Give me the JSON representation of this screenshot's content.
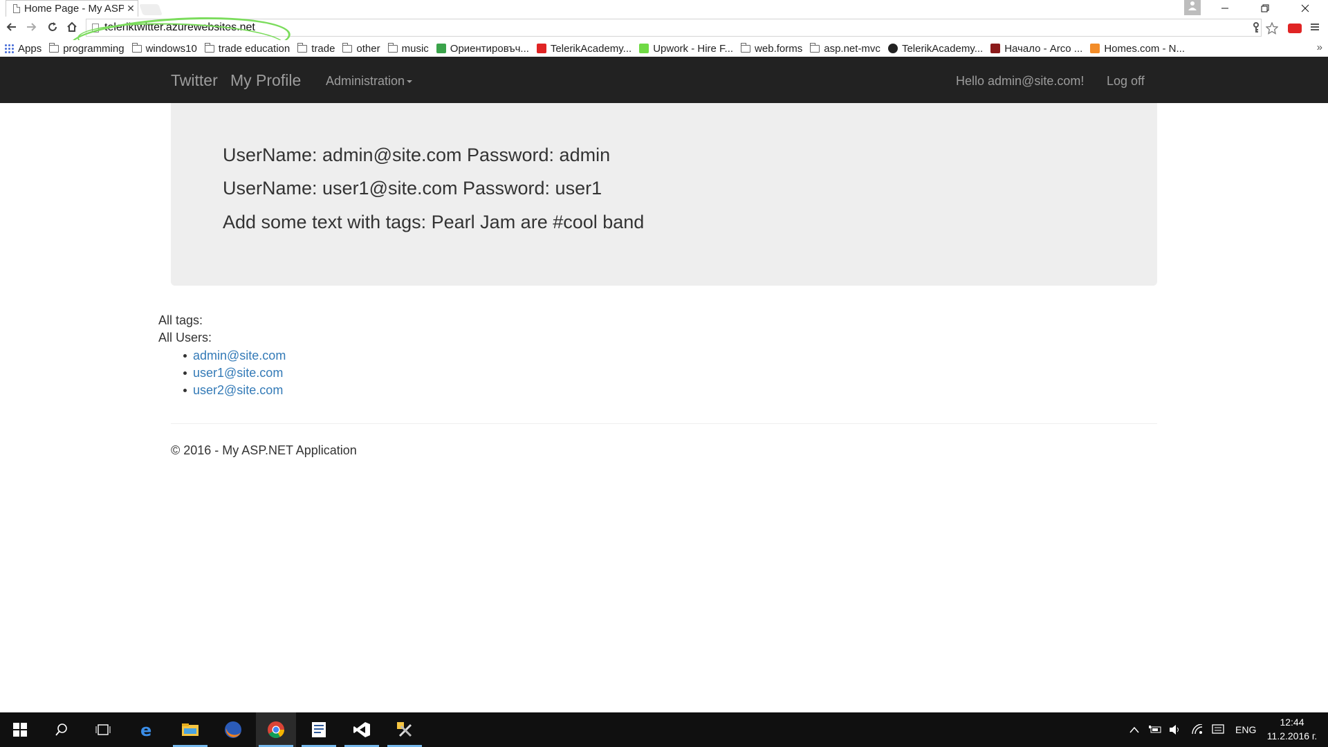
{
  "browser": {
    "tab_title": "Home Page - My ASP",
    "tab_close": "✕",
    "url": "teleriktwitter.azurewebsites.net",
    "bookmarks": [
      {
        "label": "Apps",
        "icon": "apps-grid-icon"
      },
      {
        "label": "programming",
        "icon": "folder-icon"
      },
      {
        "label": "windows10",
        "icon": "folder-icon"
      },
      {
        "label": "trade education",
        "icon": "folder-icon"
      },
      {
        "label": "trade",
        "icon": "folder-icon"
      },
      {
        "label": "other",
        "icon": "folder-icon"
      },
      {
        "label": "music",
        "icon": "folder-icon"
      },
      {
        "label": "Ориентировъч...",
        "icon": "green-star-icon"
      },
      {
        "label": "TelerikAcademy...",
        "icon": "youtube-icon"
      },
      {
        "label": "Upwork - Hire F...",
        "icon": "upwork-icon"
      },
      {
        "label": "web.forms",
        "icon": "folder-icon"
      },
      {
        "label": "asp.net-mvc",
        "icon": "folder-icon"
      },
      {
        "label": "TelerikAcademy...",
        "icon": "github-icon"
      },
      {
        "label": "Начало - Arco ...",
        "icon": "arco-icon"
      },
      {
        "label": "Homes.com - N...",
        "icon": "homes-icon"
      }
    ],
    "bookmarks_more": "»"
  },
  "navbar": {
    "brand": "Twitter",
    "my_profile": "My Profile",
    "administration": "Administration",
    "greeting": "Hello admin@site.com!",
    "logoff": "Log off"
  },
  "jumbotron": {
    "line1": "UserName: admin@site.com Password: admin",
    "line2": "UserName: user1@site.com Password: user1",
    "line3": "Add some text with tags: Pearl Jam are #cool band"
  },
  "main": {
    "all_tags_label": "All tags:",
    "all_users_label": "All Users:",
    "users": [
      "admin@site.com",
      "user1@site.com",
      "user2@site.com"
    ]
  },
  "footer": {
    "text": "© 2016 - My ASP.NET Application"
  },
  "taskbar": {
    "language": "ENG",
    "time": "12:44",
    "date": "11.2.2016 г."
  },
  "colors": {
    "navbar_bg": "#222222",
    "navbar_text": "#9d9d9d",
    "jumbotron_bg": "#eeeeee",
    "link": "#337ab7",
    "url_highlight": "#7bdc5c"
  }
}
